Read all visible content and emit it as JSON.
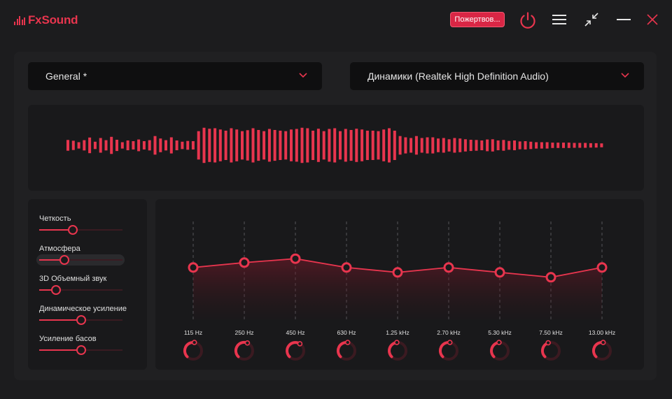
{
  "app": {
    "name": "FxSound"
  },
  "toolbar": {
    "donate_label": "Пожертвов..."
  },
  "preset": {
    "selected": "General *"
  },
  "output": {
    "selected": "Динамики (Realtek High Definition Audio)"
  },
  "effects": [
    {
      "label": "Четкость",
      "value": 0.4
    },
    {
      "label": "Атмосфера",
      "value": 0.3
    },
    {
      "label": "3D Объемный звук",
      "value": 0.2
    },
    {
      "label": "Динамическое усиление",
      "value": 0.5
    },
    {
      "label": "Усиление басов",
      "value": 0.5
    }
  ],
  "eq": {
    "bands": [
      "115 Hz",
      "250 Hz",
      "450 Hz",
      "630 Hz",
      "1.25 kHz",
      "2.70 kHz",
      "5.30 kHz",
      "7.50 kHz",
      "13.00 kHz"
    ],
    "levels": [
      0.53,
      0.58,
      0.62,
      0.53,
      0.48,
      0.53,
      0.48,
      0.43,
      0.53
    ]
  },
  "visualizer": {
    "levels": [
      0.22,
      0.19,
      0.13,
      0.21,
      0.32,
      0.15,
      0.3,
      0.21,
      0.35,
      0.23,
      0.13,
      0.2,
      0.17,
      0.24,
      0.17,
      0.21,
      0.38,
      0.28,
      0.21,
      0.33,
      0.2,
      0.15,
      0.18,
      0.17,
      0.58,
      0.72,
      0.68,
      0.7,
      0.65,
      0.6,
      0.7,
      0.65,
      0.58,
      0.62,
      0.7,
      0.63,
      0.58,
      0.67,
      0.63,
      0.6,
      0.58,
      0.65,
      0.67,
      0.72,
      0.7,
      0.6,
      0.68,
      0.58,
      0.67,
      0.7,
      0.58,
      0.67,
      0.63,
      0.68,
      0.65,
      0.6,
      0.6,
      0.58,
      0.65,
      0.7,
      0.6,
      0.38,
      0.33,
      0.3,
      0.38,
      0.3,
      0.33,
      0.33,
      0.28,
      0.3,
      0.25,
      0.3,
      0.28,
      0.25,
      0.23,
      0.22,
      0.2,
      0.24,
      0.25,
      0.2,
      0.22,
      0.18,
      0.2,
      0.16,
      0.17,
      0.15,
      0.13,
      0.13,
      0.13,
      0.11,
      0.11,
      0.11,
      0.11,
      0.1,
      0.1,
      0.1,
      0.09,
      0.09,
      0.08
    ]
  },
  "colors": {
    "accent": "#e8354e",
    "background": "#1c1c1e",
    "panel": "#19191b"
  }
}
